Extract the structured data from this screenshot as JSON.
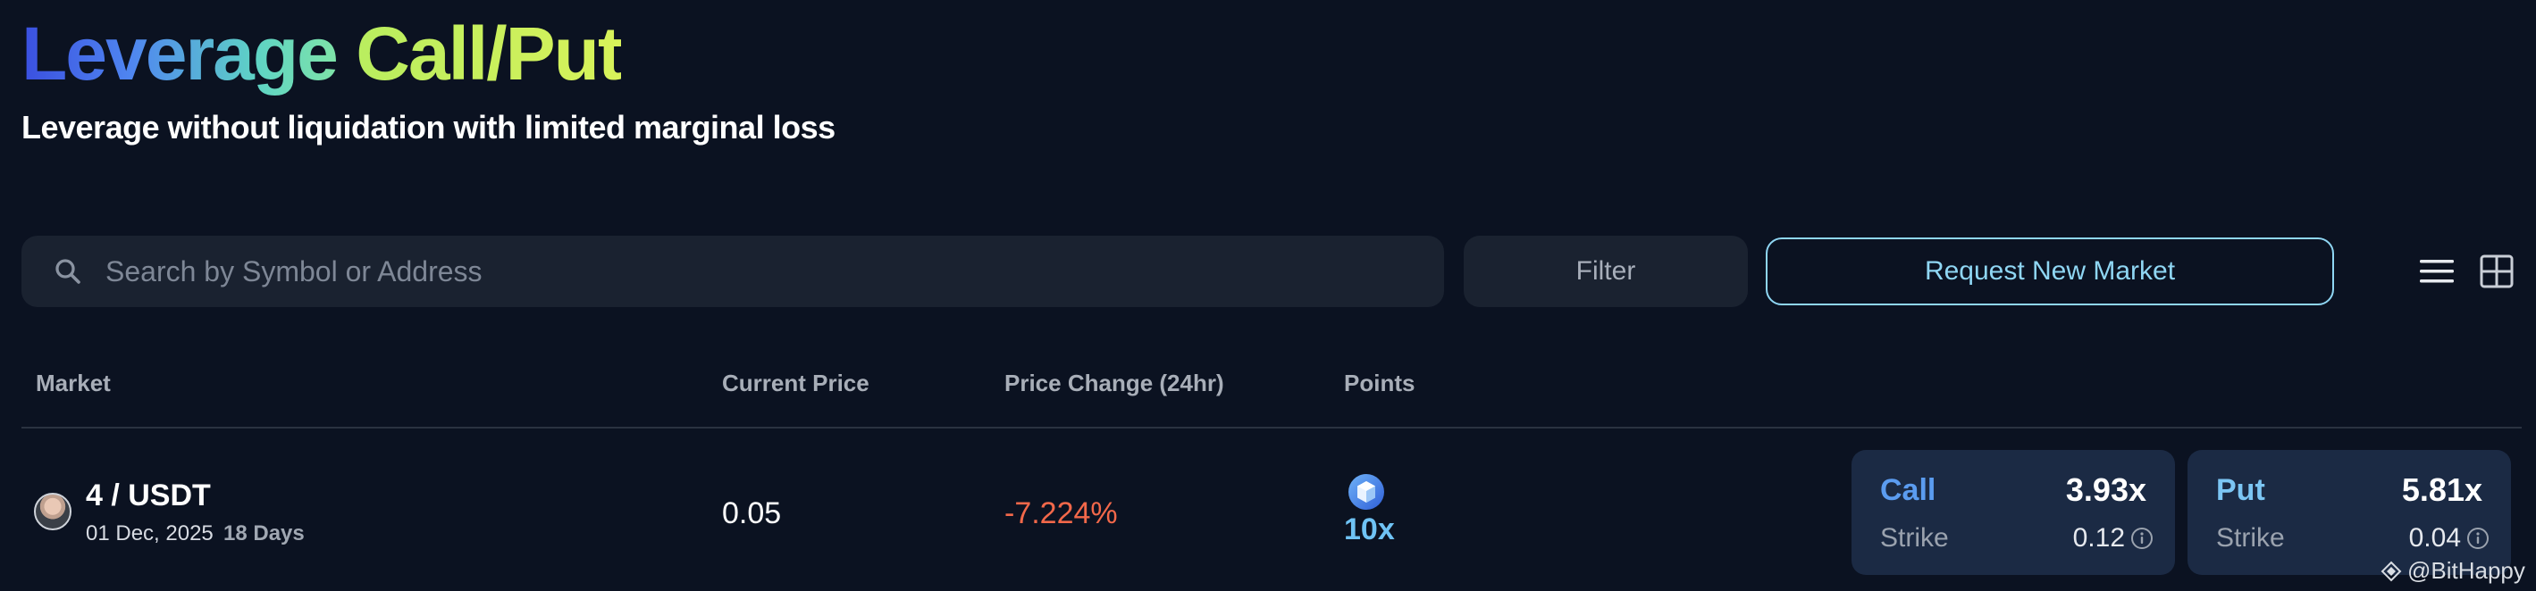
{
  "header": {
    "title_part1": "Leverage",
    "title_part2": "Call/Put",
    "subtitle": "Leverage without liquidation with limited marginal loss"
  },
  "toolbar": {
    "search_placeholder": "Search by Symbol or Address",
    "search_value": "",
    "filter_label": "Filter",
    "request_label": "Request New Market"
  },
  "table": {
    "columns": [
      "Market",
      "Current Price",
      "Price Change (24hr)",
      "Points"
    ],
    "rows": [
      {
        "market": "4 / USDT",
        "date": "01 Dec, 2025",
        "days": "18 Days",
        "current_price": "0.05",
        "price_change": "-7.224%",
        "points": "10x",
        "call": {
          "label": "Call",
          "multiplier": "3.93x",
          "strike_label": "Strike",
          "strike": "0.12"
        },
        "put": {
          "label": "Put",
          "multiplier": "5.81x",
          "strike_label": "Strike",
          "strike": "0.04"
        }
      }
    ]
  },
  "watermark": "@BitHappy",
  "icons": {
    "search": "search-icon",
    "list_view": "list-view-icon",
    "grid_view": "grid-view-icon",
    "points": "points-badge-icon",
    "info": "info-icon"
  },
  "colors": {
    "background": "#0b1221",
    "accent_blue": "#8fd6f3",
    "negative": "#f2684a",
    "call": "#5b9cf0",
    "put": "#7cc6f4",
    "card_bg": "#1b2a44"
  }
}
